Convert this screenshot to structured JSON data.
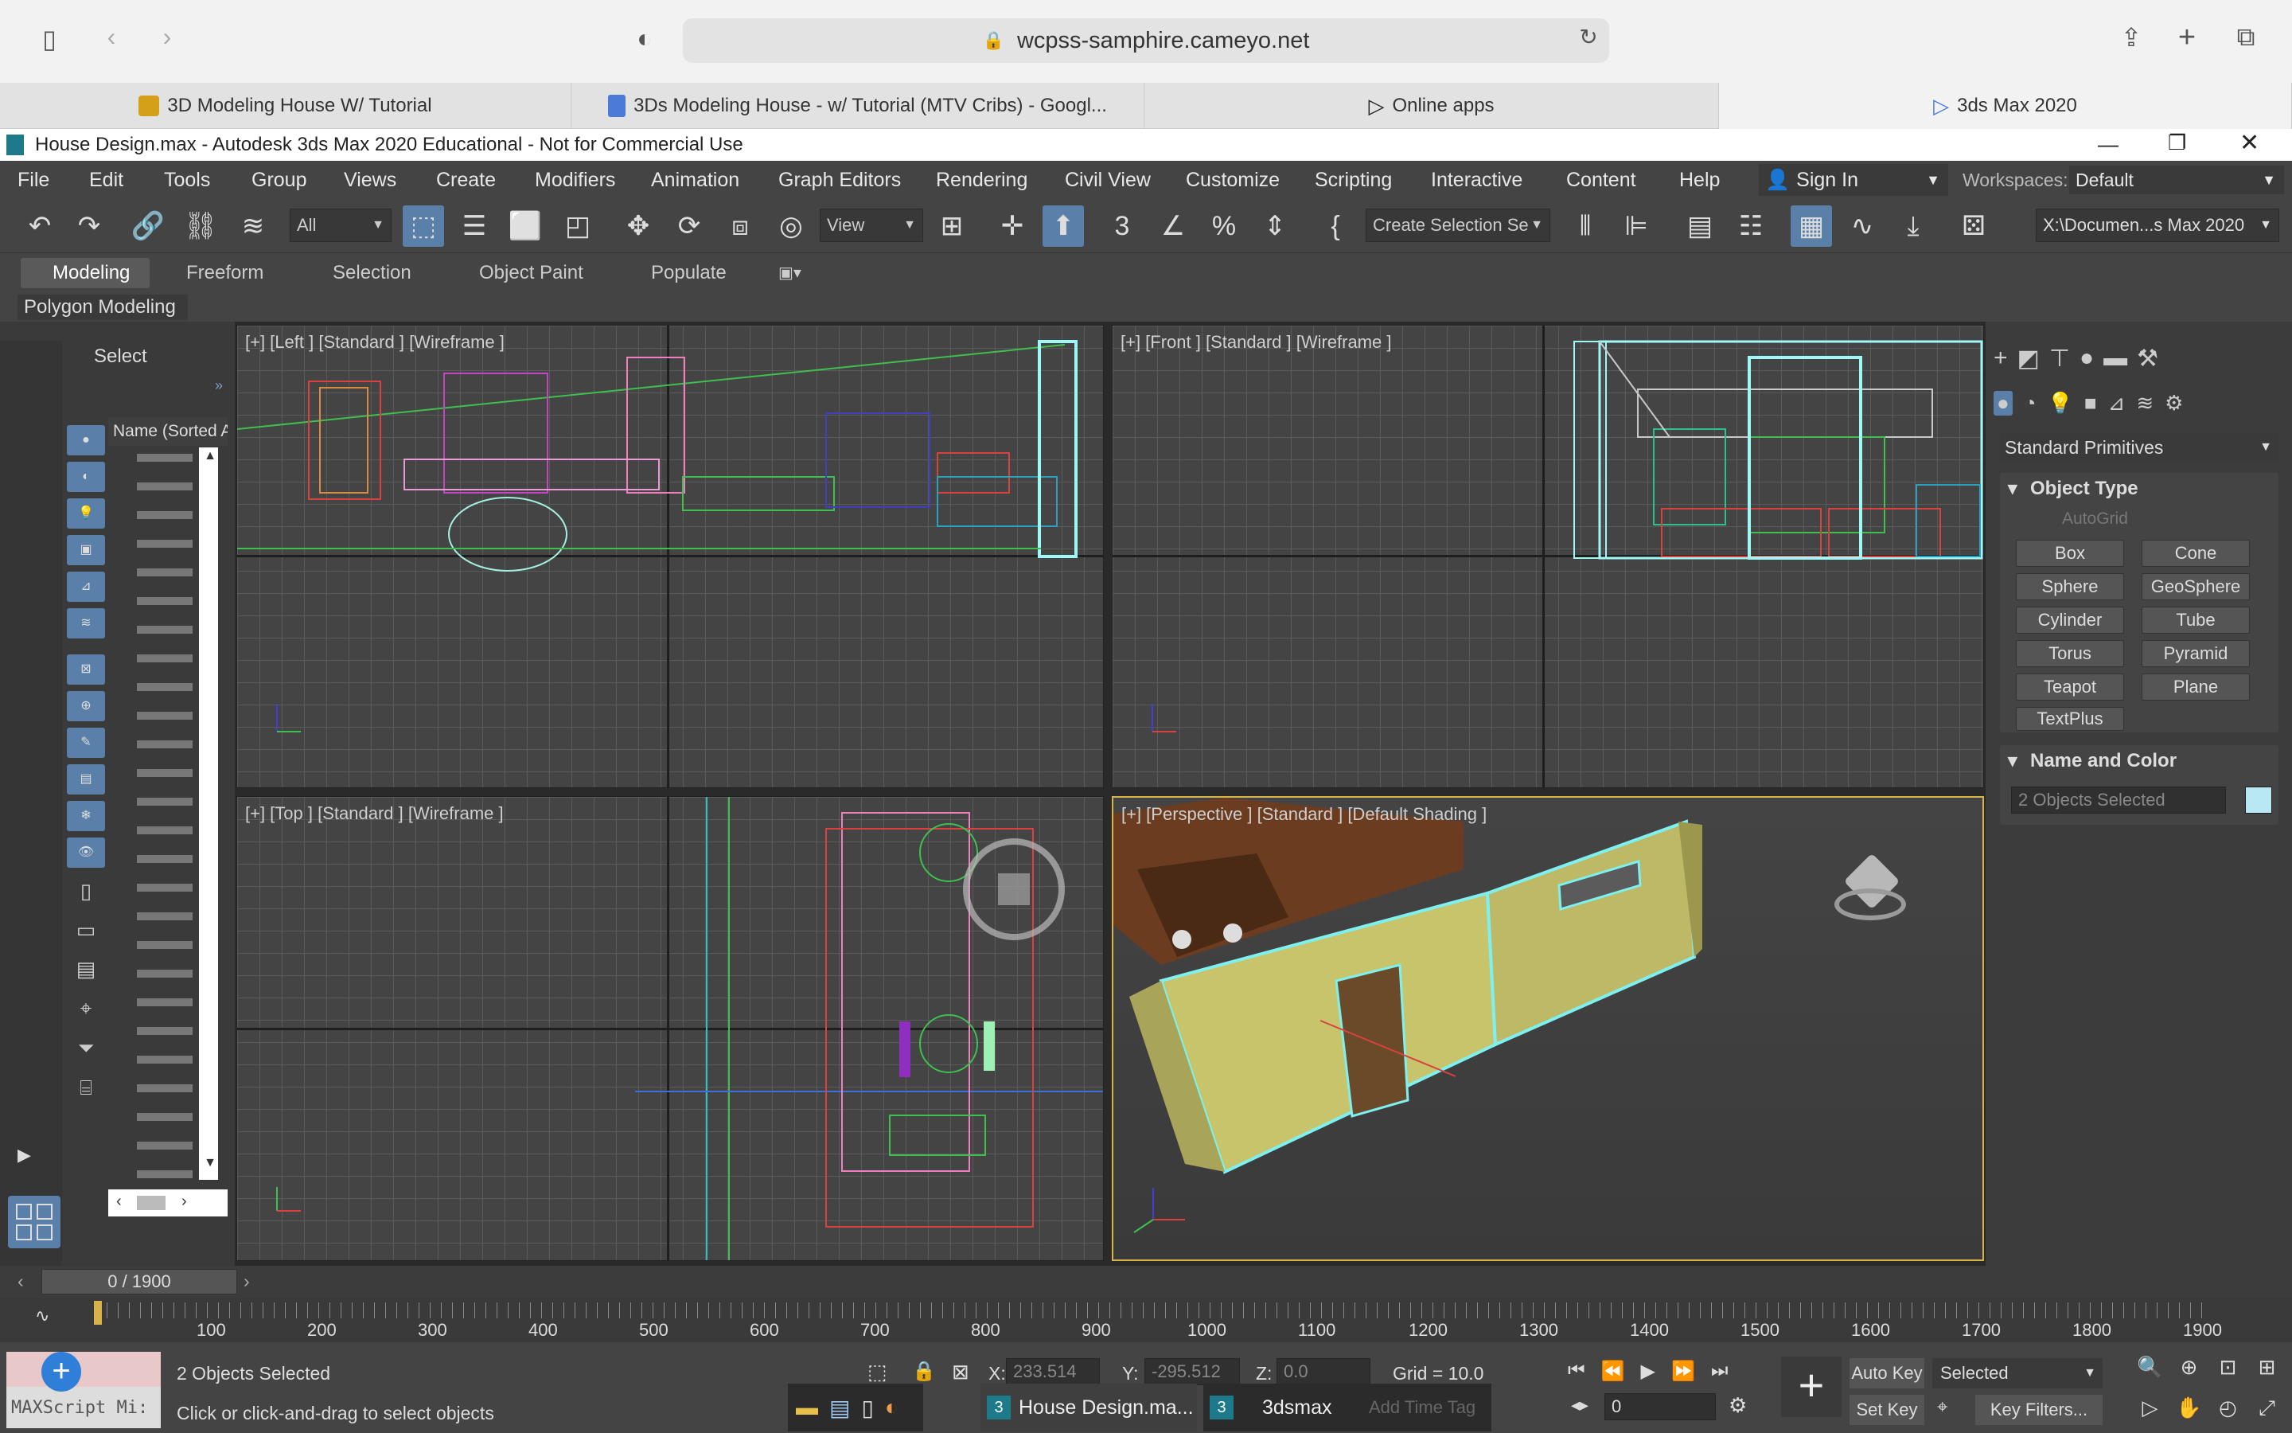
{
  "browser": {
    "url": "wcpss-samphire.cameyo.net",
    "tabs": [
      {
        "label": "3D Modeling House W/ Tutorial"
      },
      {
        "label": "3Ds Modeling House - w/ Tutorial (MTV Cribs) - Googl..."
      },
      {
        "label": "Online apps"
      },
      {
        "label": "3ds Max 2020"
      }
    ]
  },
  "app": {
    "title": "House Design.max - Autodesk 3ds Max 2020 Educational - Not for Commercial Use",
    "menus": [
      "File",
      "Edit",
      "Tools",
      "Group",
      "Views",
      "Create",
      "Modifiers",
      "Animation",
      "Graph Editors",
      "Rendering",
      "Civil View",
      "Customize",
      "Scripting",
      "Interactive",
      "Content",
      "Help"
    ],
    "sign_in": "Sign In",
    "workspaces_label": "Workspaces:",
    "workspace_value": "Default",
    "selection_filter": "All",
    "ref_coord": "View",
    "selection_set": "Create Selection Se",
    "project_path": "X:\\Documen...s Max 2020",
    "ribbon_tabs": [
      "Modeling",
      "Freeform",
      "Selection",
      "Object Paint",
      "Populate"
    ],
    "ribbon_sub": "Polygon Modeling"
  },
  "scene_explorer": {
    "title": "Select",
    "column": "Name (Sorted A"
  },
  "viewports": {
    "left": "[+] [Left ] [Standard ] [Wireframe ]",
    "front": "[+] [Front ] [Standard ] [Wireframe ]",
    "top": "[+] [Top ] [Standard ] [Wireframe ]",
    "perspective": "[+] [Perspective ] [Standard ] [Default Shading ]"
  },
  "command_panel": {
    "category": "Standard Primitives",
    "object_type_title": "Object Type",
    "autogrid": "AutoGrid",
    "buttons": [
      "Box",
      "Cone",
      "Sphere",
      "GeoSphere",
      "Cylinder",
      "Tube",
      "Torus",
      "Pyramid",
      "Teapot",
      "Plane",
      "TextPlus"
    ],
    "name_color_title": "Name and Color",
    "name_field": "2 Objects Selected",
    "swatch_color": "#b9e8f5"
  },
  "timeline": {
    "frame": "0 / 1900",
    "ticks": [
      "100",
      "200",
      "300",
      "400",
      "500",
      "600",
      "700",
      "800",
      "900",
      "1000",
      "1100",
      "1200",
      "1300",
      "1400",
      "1500",
      "1600",
      "1700",
      "1800",
      "1900"
    ]
  },
  "status": {
    "maxscript": "MAXScript Mi:",
    "selected": "2 Objects Selected",
    "prompt": "Click or click-and-drag to select objects",
    "x_label": "X:",
    "x_value": "233.514",
    "y_label": "Y:",
    "y_value": "-295.512",
    "z_label": "Z:",
    "z_value": "0.0",
    "grid": "Grid = 10.0",
    "auto_key": "Auto Key",
    "set_key": "Set Key",
    "key_mode": "Selected",
    "frame_field": "0",
    "key_filters": "Key Filters...",
    "add_time_tag": "Add Time Tag"
  },
  "taskbar": {
    "item1": "House Design.ma...",
    "item2": "3dsmax"
  }
}
